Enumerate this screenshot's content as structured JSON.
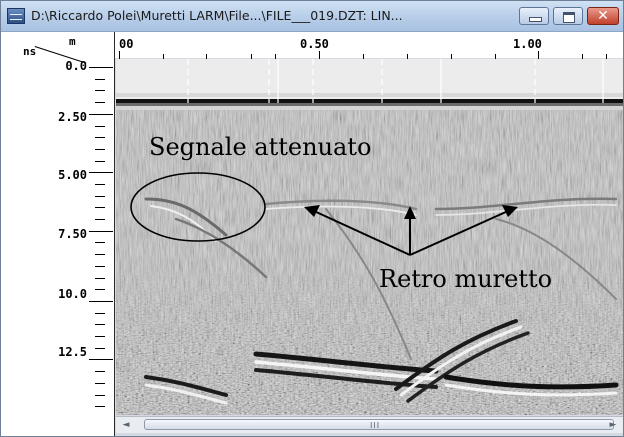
{
  "window": {
    "title": "D:\\Riccardo Polei\\Muretti LARM\\File...\\FILE___019.DZT:  LIN...",
    "buttons": {
      "minimize": "minimize-icon",
      "maximize": "maximize-icon",
      "close": "✕"
    }
  },
  "axes": {
    "x_unit": "m",
    "y_unit": "ns",
    "x_labels": [
      "00",
      "0.50",
      "1.00"
    ],
    "y_labels": [
      "0.0",
      "2.50",
      "5.00",
      "7.50",
      "10.0",
      "12.5"
    ]
  },
  "annotations": {
    "attenuated_signal": "Segnale attenuato",
    "behind_wall": "Retro muretto"
  },
  "scrollbar": {
    "left_arrow": "◄",
    "right_arrow": "►",
    "grip": "III"
  }
}
